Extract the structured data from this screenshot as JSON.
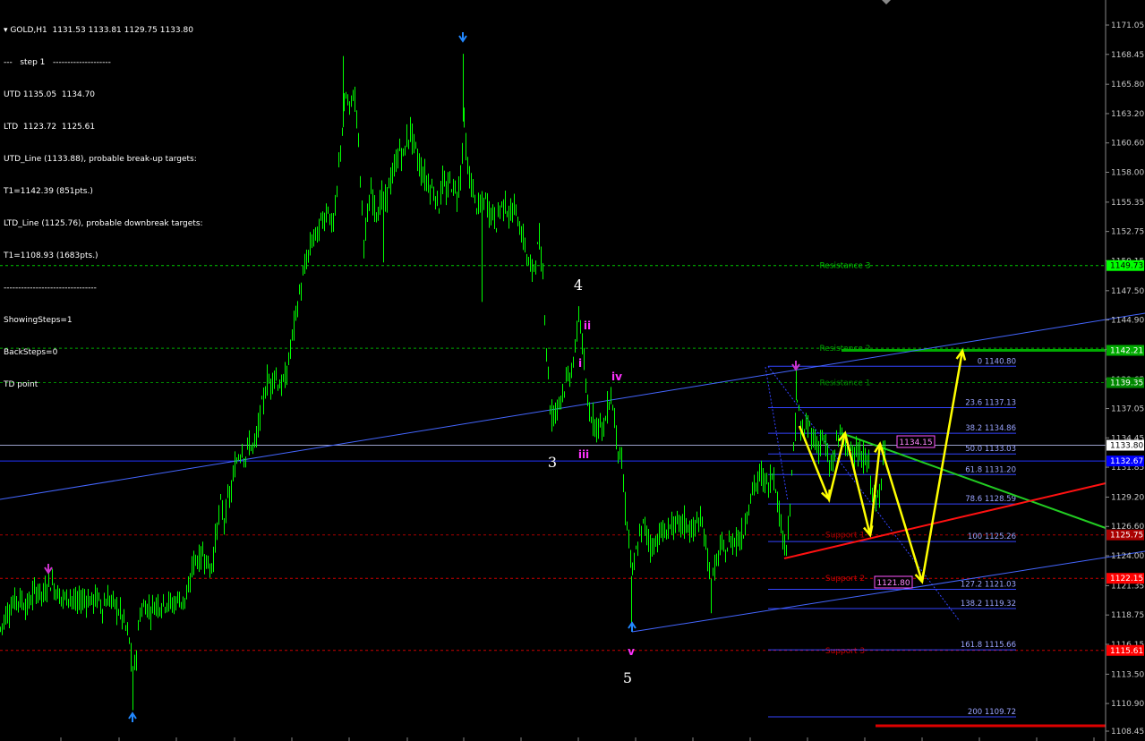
{
  "header": {
    "symbol": "GOLD,H1",
    "ohlc": "1131.53 1133.81 1129.75 1133.80"
  },
  "info_lines": [
    "---   step 1   --------------------",
    "UTD 1135.05  1134.70",
    "LTD  1123.72  1125.61",
    "UTD_Line (1133.88), probable break-up targets:",
    "T1=1142.39 (851pts.)",
    "LTD_Line (1125.76), probable downbreak targets:",
    "T1=1108.93 (1683pts.)",
    "--------------------------------",
    "ShowingSteps=1",
    "BackSteps=0",
    "TD point"
  ],
  "colors": {
    "background": "#000000",
    "candle": "#00ff00",
    "fib": "#3344ff",
    "trend": "#4466ff",
    "resistance": "#00c000",
    "support": "#c00000",
    "projection": "#ffff00",
    "wave_labels": "#ffffff",
    "sub_labels": "#ff33ff"
  },
  "chart_data": {
    "type": "candlestick",
    "instrument": "GOLD",
    "timeframe": "H1",
    "y_axis": {
      "range": [
        1108.45,
        1171.05
      ],
      "ticks": [
        "1171.05",
        "1168.45",
        "1165.80",
        "1163.20",
        "1160.60",
        "1158.00",
        "1155.35",
        "1152.75",
        "1150.15",
        "1147.50",
        "1144.90",
        "1142.30",
        "1139.65",
        "1137.05",
        "1134.45",
        "1131.85",
        "1129.20",
        "1126.60",
        "1124.00",
        "1121.35",
        "1118.75",
        "1116.15",
        "1113.50",
        "1110.90",
        "1108.45"
      ]
    },
    "axis_tags": [
      {
        "label": "1149.73",
        "value": 1149.73,
        "color": "#00ff00"
      },
      {
        "label": "1142.21",
        "value": 1142.21,
        "color": "#00aa00"
      },
      {
        "label": "1139.35",
        "value": 1139.35,
        "color": "#008800"
      },
      {
        "label": "1133.80",
        "value": 1133.8,
        "color": "#ffffff"
      },
      {
        "label": "1132.67",
        "value": 1132.4,
        "color": "#0000ff"
      },
      {
        "label": "1125.75",
        "value": 1125.85,
        "color": "#aa0000"
      },
      {
        "label": "1122.15",
        "value": 1122.0,
        "color": "#ff0000"
      },
      {
        "label": "1115.61",
        "value": 1115.61,
        "color": "#ff0000"
      }
    ],
    "levels": [
      {
        "name": "Resistance 3",
        "value": 1149.73,
        "color": "#00cc00"
      },
      {
        "name": "Resistance 2",
        "value": 1142.4,
        "color": "#00aa00"
      },
      {
        "name": "Resistance 1",
        "value": 1139.35,
        "color": "#008800"
      },
      {
        "name": "Support 1",
        "value": 1125.85,
        "color": "#aa0000"
      },
      {
        "name": "Support 2",
        "value": 1122.0,
        "color": "#cc0000"
      },
      {
        "name": "Support 3",
        "value": 1115.61,
        "color": "#cc0000"
      }
    ],
    "fib_levels": [
      {
        "label": "0 1140.80",
        "value": 1140.8
      },
      {
        "label": "23.6 1137.13",
        "value": 1137.13
      },
      {
        "label": "38.2 1134.86",
        "value": 1134.86
      },
      {
        "label": "50.0 1133.03",
        "value": 1133.03
      },
      {
        "label": "61.8 1131.20",
        "value": 1131.2
      },
      {
        "label": "78.6 1128.59",
        "value": 1128.59
      },
      {
        "label": "100 1125.26",
        "value": 1125.26
      },
      {
        "label": "127.2 1121.03",
        "value": 1121.03
      },
      {
        "label": "138.2 1119.32",
        "value": 1119.32
      },
      {
        "label": "161.8 1115.66",
        "value": 1115.66
      },
      {
        "label": "200 1109.72",
        "value": 1109.72
      }
    ],
    "price_boxes": [
      {
        "label": "1134.15",
        "value": 1134.15
      },
      {
        "label": "1121.80",
        "value": 1121.8
      }
    ],
    "wave_labels": [
      "4",
      "3",
      "5"
    ],
    "sub_wave_labels": [
      "ii",
      "i",
      "iv",
      "iii",
      "v"
    ],
    "close_price": 1133.8,
    "path": [
      [
        0,
        1117.5
      ],
      [
        6,
        1118.8
      ],
      [
        12,
        1119.5
      ],
      [
        18,
        1120.2
      ],
      [
        24,
        1120.0
      ],
      [
        30,
        1119.5
      ],
      [
        36,
        1120.5
      ],
      [
        42,
        1121.0
      ],
      [
        48,
        1120.4
      ],
      [
        54,
        1121.8
      ],
      [
        60,
        1121.3
      ],
      [
        66,
        1120.5
      ],
      [
        72,
        1120.2
      ],
      [
        78,
        1120.6
      ],
      [
        84,
        1119.6
      ],
      [
        90,
        1120.1
      ],
      [
        96,
        1120.2
      ],
      [
        102,
        1120.0
      ],
      [
        108,
        1120.3
      ],
      [
        114,
        1119.5
      ],
      [
        120,
        1120.2
      ],
      [
        126,
        1119.8
      ],
      [
        132,
        1119.2
      ],
      [
        138,
        1118.2
      ],
      [
        144,
        1116.5
      ],
      [
        148,
        1113.2
      ],
      [
        152,
        1115.5
      ],
      [
        156,
        1119.0
      ],
      [
        162,
        1119.6
      ],
      [
        168,
        1119.2
      ],
      [
        174,
        1119.8
      ],
      [
        180,
        1119.7
      ],
      [
        186,
        1120.0
      ],
      [
        192,
        1119.6
      ],
      [
        198,
        1120.2
      ],
      [
        204,
        1120.0
      ],
      [
        210,
        1120.5
      ],
      [
        214,
        1123.0
      ],
      [
        218,
        1123.8
      ],
      [
        222,
        1123.6
      ],
      [
        226,
        1124.2
      ],
      [
        230,
        1123.8
      ],
      [
        234,
        1122.6
      ],
      [
        238,
        1124.0
      ],
      [
        242,
        1126.5
      ],
      [
        246,
        1128.5
      ],
      [
        250,
        1127.2
      ],
      [
        254,
        1128.8
      ],
      [
        258,
        1129.8
      ],
      [
        262,
        1131.8
      ],
      [
        266,
        1133.0
      ],
      [
        270,
        1133.5
      ],
      [
        274,
        1132.7
      ],
      [
        278,
        1134.0
      ],
      [
        282,
        1133.6
      ],
      [
        286,
        1134.2
      ],
      [
        290,
        1136.5
      ],
      [
        294,
        1137.8
      ],
      [
        298,
        1139.6
      ],
      [
        302,
        1139.2
      ],
      [
        306,
        1140.3
      ],
      [
        310,
        1139.4
      ],
      [
        314,
        1139.0
      ],
      [
        318,
        1139.6
      ],
      [
        322,
        1141.2
      ],
      [
        326,
        1143.5
      ],
      [
        330,
        1145.3
      ],
      [
        334,
        1147.2
      ],
      [
        338,
        1148.6
      ],
      [
        342,
        1150.2
      ],
      [
        346,
        1151.2
      ],
      [
        350,
        1152.5
      ],
      [
        354,
        1152.3
      ],
      [
        358,
        1153.6
      ],
      [
        362,
        1154.0
      ],
      [
        366,
        1155.0
      ],
      [
        370,
        1153.2
      ],
      [
        374,
        1154.3
      ],
      [
        378,
        1158.5
      ],
      [
        382,
        1162.0
      ],
      [
        386,
        1164.8
      ],
      [
        390,
        1163.5
      ],
      [
        394,
        1165.0
      ],
      [
        398,
        1163.5
      ],
      [
        402,
        1157.5
      ],
      [
        406,
        1152.0
      ],
      [
        410,
        1153.8
      ],
      [
        414,
        1156.2
      ],
      [
        418,
        1155.0
      ],
      [
        422,
        1154.5
      ],
      [
        426,
        1155.8
      ],
      [
        430,
        1155.2
      ],
      [
        434,
        1157.0
      ],
      [
        438,
        1157.5
      ],
      [
        442,
        1158.9
      ],
      [
        446,
        1160.0
      ],
      [
        450,
        1159.4
      ],
      [
        454,
        1160.8
      ],
      [
        458,
        1161.6
      ],
      [
        462,
        1160.6
      ],
      [
        466,
        1159.2
      ],
      [
        470,
        1158.2
      ],
      [
        474,
        1157.6
      ],
      [
        478,
        1157.0
      ],
      [
        482,
        1156.5
      ],
      [
        486,
        1156.0
      ],
      [
        490,
        1155.0
      ],
      [
        494,
        1157.3
      ],
      [
        498,
        1156.0
      ],
      [
        502,
        1157.2
      ],
      [
        506,
        1156.7
      ],
      [
        510,
        1156.0
      ],
      [
        514,
        1157.8
      ],
      [
        518,
        1162.5
      ],
      [
        522,
        1158.0
      ],
      [
        526,
        1157.1
      ],
      [
        530,
        1155.5
      ],
      [
        534,
        1154.8
      ],
      [
        538,
        1154.9
      ],
      [
        542,
        1155.6
      ],
      [
        546,
        1154.6
      ],
      [
        550,
        1154.3
      ],
      [
        554,
        1153.5
      ],
      [
        558,
        1154.9
      ],
      [
        562,
        1155.2
      ],
      [
        566,
        1154.9
      ],
      [
        570,
        1154.0
      ],
      [
        574,
        1155.0
      ],
      [
        578,
        1153.8
      ],
      [
        582,
        1152.6
      ],
      [
        586,
        1151.5
      ],
      [
        590,
        1149.9
      ],
      [
        594,
        1149.2
      ],
      [
        598,
        1150.5
      ],
      [
        602,
        1151.8
      ],
      [
        606,
        1148.8
      ],
      [
        610,
        1142.5
      ],
      [
        614,
        1137.5
      ],
      [
        618,
        1136.5
      ],
      [
        622,
        1137.2
      ],
      [
        626,
        1138.3
      ],
      [
        630,
        1139.0
      ],
      [
        634,
        1139.6
      ],
      [
        638,
        1140.6
      ],
      [
        642,
        1141.9
      ],
      [
        646,
        1145.7
      ],
      [
        650,
        1143.0
      ],
      [
        654,
        1138.4
      ],
      [
        658,
        1136.9
      ],
      [
        662,
        1136.2
      ],
      [
        666,
        1135.6
      ],
      [
        670,
        1135.8
      ],
      [
        674,
        1135.2
      ],
      [
        678,
        1137.0
      ],
      [
        682,
        1138.3
      ],
      [
        686,
        1136.1
      ],
      [
        690,
        1133.6
      ],
      [
        694,
        1132.1
      ],
      [
        698,
        1128.2
      ],
      [
        702,
        1125.4
      ],
      [
        706,
        1122.2
      ],
      [
        710,
        1124.2
      ],
      [
        714,
        1125.6
      ],
      [
        718,
        1126.7
      ],
      [
        722,
        1126.1
      ],
      [
        726,
        1125.0
      ],
      [
        730,
        1124.9
      ],
      [
        734,
        1125.6
      ],
      [
        738,
        1126.2
      ],
      [
        742,
        1125.7
      ],
      [
        746,
        1126.6
      ],
      [
        750,
        1126.7
      ],
      [
        754,
        1126.5
      ],
      [
        758,
        1126.8
      ],
      [
        762,
        1126.9
      ],
      [
        766,
        1126.8
      ],
      [
        770,
        1126.5
      ],
      [
        774,
        1126.0
      ],
      [
        778,
        1127.2
      ],
      [
        782,
        1126.8
      ],
      [
        786,
        1126.0
      ],
      [
        790,
        1124.0
      ],
      [
        794,
        1121.5
      ],
      [
        798,
        1122.8
      ],
      [
        802,
        1124.0
      ],
      [
        806,
        1124.8
      ],
      [
        810,
        1124.2
      ],
      [
        814,
        1125.1
      ],
      [
        818,
        1125.3
      ],
      [
        822,
        1125.6
      ],
      [
        826,
        1125.5
      ],
      [
        830,
        1126.0
      ],
      [
        834,
        1128.0
      ],
      [
        838,
        1129.1
      ],
      [
        842,
        1130.2
      ],
      [
        846,
        1130.4
      ],
      [
        850,
        1131.3
      ],
      [
        854,
        1130.6
      ],
      [
        858,
        1130.2
      ],
      [
        862,
        1131.3
      ],
      [
        866,
        1130.5
      ],
      [
        870,
        1127.6
      ],
      [
        874,
        1125.8
      ],
      [
        878,
        1125.1
      ],
      [
        882,
        1128.0
      ],
      [
        886,
        1133.5
      ],
      [
        890,
        1137.8
      ],
      [
        894,
        1135.2
      ],
      [
        898,
        1134.8
      ],
      [
        902,
        1135.6
      ],
      [
        906,
        1135.0
      ],
      [
        910,
        1134.0
      ],
      [
        914,
        1133.7
      ],
      [
        918,
        1134.6
      ],
      [
        922,
        1133.7
      ],
      [
        926,
        1131.5
      ],
      [
        930,
        1132.5
      ],
      [
        934,
        1133.8
      ],
      [
        938,
        1135.2
      ],
      [
        942,
        1134.1
      ],
      [
        946,
        1133.0
      ],
      [
        950,
        1133.9
      ],
      [
        954,
        1133.4
      ],
      [
        958,
        1133.0
      ],
      [
        962,
        1132.2
      ],
      [
        966,
        1132.9
      ],
      [
        970,
        1131.8
      ],
      [
        974,
        1129.9
      ],
      [
        978,
        1128.5
      ],
      [
        982,
        1129.2
      ],
      [
        986,
        1133.5
      ],
      [
        990,
        1133.8
      ]
    ]
  }
}
